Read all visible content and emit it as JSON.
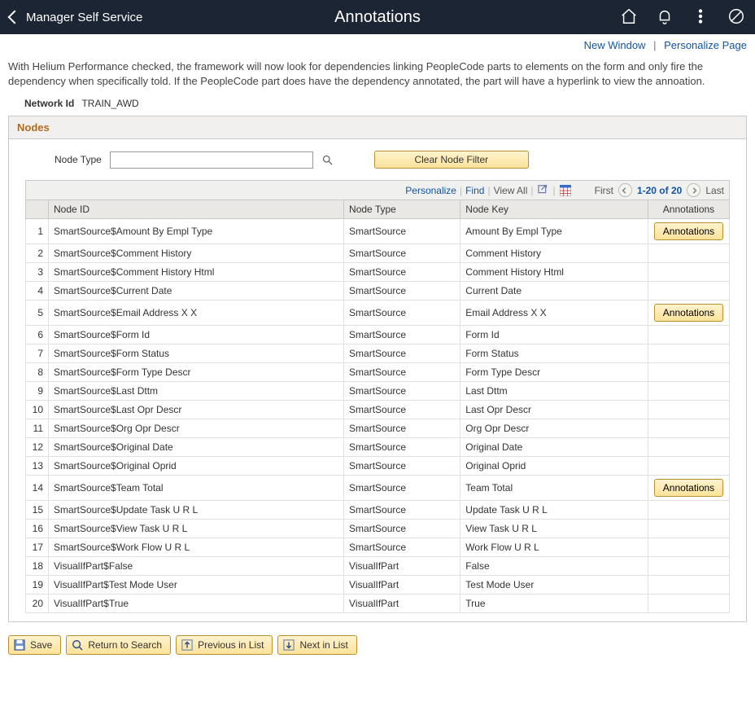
{
  "topbar": {
    "back_label": "Manager Self Service",
    "title": "Annotations"
  },
  "subheader": {
    "new_window": "New Window",
    "personalize": "Personalize Page"
  },
  "intro_text": "With Helium Performance checked, the framework will now look for dependencies linking PeopleCode parts to elements on the form and only fire the dependency when specifically told. If the PeopleCode part does have the dependency annotated, the part will have a hyperlink to view the annoation.",
  "network": {
    "label": "Network Id",
    "value": "TRAIN_AWD"
  },
  "section": {
    "title": "Nodes",
    "node_type_label": "Node Type",
    "node_type_value": "",
    "clear_filter": "Clear Node Filter"
  },
  "gridbar": {
    "personalize": "Personalize",
    "find": "Find",
    "view_all": "View All",
    "first": "First",
    "range": "1-20 of 20",
    "last": "Last"
  },
  "columns": {
    "node_id": "Node ID",
    "node_type": "Node Type",
    "node_key": "Node Key",
    "annotations": "Annotations"
  },
  "annotations_btn": "Annotations",
  "rows": [
    {
      "n": "1",
      "id": "SmartSource$Amount By Empl Type",
      "type": "SmartSource",
      "key": "Amount By Empl Type",
      "ann": true
    },
    {
      "n": "2",
      "id": "SmartSource$Comment History",
      "type": "SmartSource",
      "key": "Comment History",
      "ann": false
    },
    {
      "n": "3",
      "id": "SmartSource$Comment History Html",
      "type": "SmartSource",
      "key": "Comment History Html",
      "ann": false
    },
    {
      "n": "4",
      "id": "SmartSource$Current Date",
      "type": "SmartSource",
      "key": "Current Date",
      "ann": false
    },
    {
      "n": "5",
      "id": "SmartSource$Email Address X X",
      "type": "SmartSource",
      "key": "Email Address X X",
      "ann": true
    },
    {
      "n": "6",
      "id": "SmartSource$Form Id",
      "type": "SmartSource",
      "key": "Form Id",
      "ann": false
    },
    {
      "n": "7",
      "id": "SmartSource$Form Status",
      "type": "SmartSource",
      "key": "Form Status",
      "ann": false
    },
    {
      "n": "8",
      "id": "SmartSource$Form Type Descr",
      "type": "SmartSource",
      "key": "Form Type Descr",
      "ann": false
    },
    {
      "n": "9",
      "id": "SmartSource$Last Dttm",
      "type": "SmartSource",
      "key": "Last Dttm",
      "ann": false
    },
    {
      "n": "10",
      "id": "SmartSource$Last Opr Descr",
      "type": "SmartSource",
      "key": "Last Opr Descr",
      "ann": false
    },
    {
      "n": "11",
      "id": "SmartSource$Org Opr Descr",
      "type": "SmartSource",
      "key": "Org Opr Descr",
      "ann": false
    },
    {
      "n": "12",
      "id": "SmartSource$Original Date",
      "type": "SmartSource",
      "key": "Original Date",
      "ann": false
    },
    {
      "n": "13",
      "id": "SmartSource$Original Oprid",
      "type": "SmartSource",
      "key": "Original Oprid",
      "ann": false
    },
    {
      "n": "14",
      "id": "SmartSource$Team Total",
      "type": "SmartSource",
      "key": "Team Total",
      "ann": true
    },
    {
      "n": "15",
      "id": "SmartSource$Update Task U R L",
      "type": "SmartSource",
      "key": "Update Task U R L",
      "ann": false
    },
    {
      "n": "16",
      "id": "SmartSource$View Task U R L",
      "type": "SmartSource",
      "key": "View Task U R L",
      "ann": false
    },
    {
      "n": "17",
      "id": "SmartSource$Work Flow U R L",
      "type": "SmartSource",
      "key": "Work Flow U R L",
      "ann": false
    },
    {
      "n": "18",
      "id": "VisualIfPart$False",
      "type": "VisualIfPart",
      "key": "False",
      "ann": false
    },
    {
      "n": "19",
      "id": "VisualIfPart$Test Mode User",
      "type": "VisualIfPart",
      "key": "Test Mode User",
      "ann": false
    },
    {
      "n": "20",
      "id": "VisualIfPart$True",
      "type": "VisualIfPart",
      "key": "True",
      "ann": false
    }
  ],
  "footer": {
    "save": "Save",
    "return": "Return to Search",
    "prev": "Previous in List",
    "next": "Next in List"
  }
}
